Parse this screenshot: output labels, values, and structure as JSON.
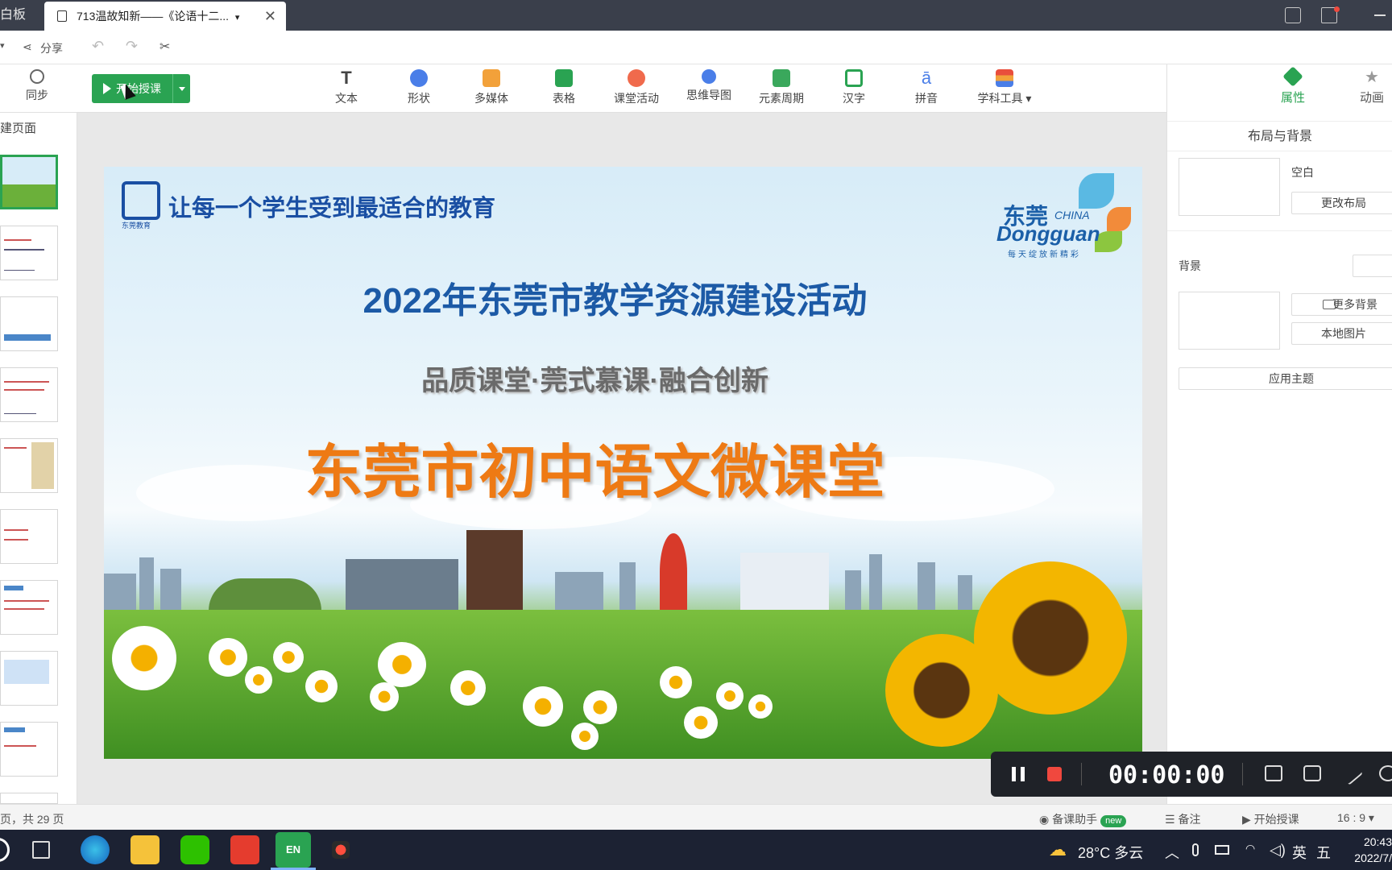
{
  "titlebar": {
    "app_tab": "白板",
    "doc_tab": "713温故知新——《论语十二...",
    "doc_tab_caret": "▾",
    "close_glyph": "✕"
  },
  "menubar": {
    "share": "分享",
    "share_prefix": "▾"
  },
  "toolbar": {
    "sync": "同步",
    "start_class": "开始授课",
    "tools": [
      "文本",
      "形状",
      "多媒体",
      "表格",
      "课堂活动",
      "思维导图",
      "元素周期",
      "汉字",
      "拼音",
      "学科工具 ▾"
    ]
  },
  "left_panel": {
    "header": "建页面"
  },
  "slide": {
    "logo_text": "让每一个学生受到最适合的教育",
    "logo_caption": "东莞教育",
    "city_cn": "东莞",
    "city_china": "CHINA",
    "city_en": "Dongguan",
    "city_slogan": "每天绽放新精彩",
    "title": "2022年东莞市教学资源建设活动",
    "subtitle": "品质课堂·莞式慕课·融合创新",
    "main": "东莞市初中语文微课堂"
  },
  "right_panel": {
    "tab_properties": "属性",
    "tab_animation": "动画",
    "section_title": "布局与背景",
    "layout_label": "空白",
    "change_layout": "更改布局",
    "background_label": "背景",
    "more_backgrounds": "更多背景",
    "local_image": "本地图片",
    "apply_theme": "应用主题"
  },
  "status_bar": {
    "page_info": "页，共 29 页",
    "assistant": "备课助手",
    "assistant_badge": "new",
    "notes": "备注",
    "start_class": "开始授课",
    "ratio": "16 : 9 ▾"
  },
  "recorder": {
    "timer": "00:00:00"
  },
  "taskbar": {
    "weather": "28°C 多云",
    "ime_lang": "英",
    "ime_mode": "五",
    "time": "20:43",
    "date": "2022/7/"
  },
  "colors": {
    "accent_green": "#2aa352",
    "title_blue": "#1c5aa6",
    "main_orange": "#ee7a14"
  }
}
